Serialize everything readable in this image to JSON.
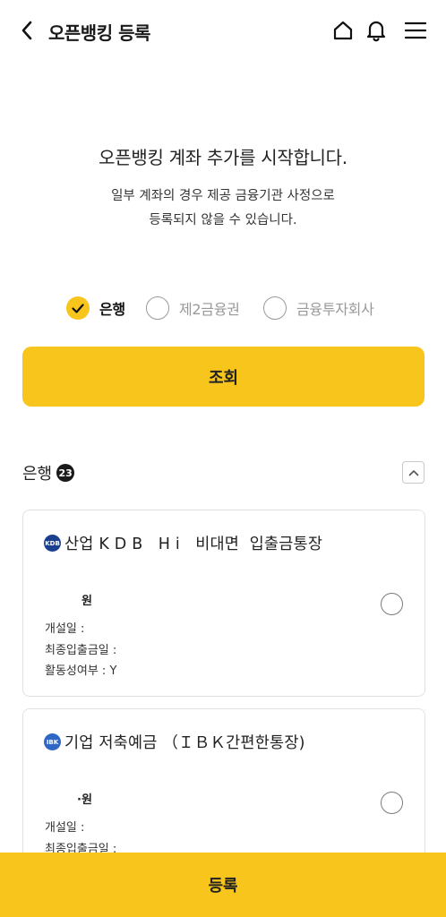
{
  "header": {
    "title": "오픈뱅킹 등록",
    "icons": [
      "back-arrow-icon",
      "home-icon",
      "bell-icon",
      "hamburger-menu-icon"
    ]
  },
  "intro": {
    "title": "오픈뱅킹 계좌 추가를 시작합니다.",
    "desc_line1": "일부 계좌의 경우 제공 금융기관 사정으로",
    "desc_line2": "등록되지 않을 수 있습니다."
  },
  "filters": {
    "options": [
      {
        "label": "은행",
        "checked": true
      },
      {
        "label": "제2금융권",
        "checked": false
      },
      {
        "label": "금융투자회사",
        "checked": false
      }
    ]
  },
  "search_button": "조회",
  "section": {
    "title": "은행",
    "count": "23"
  },
  "accounts": [
    {
      "logo": "KDB",
      "name": "산업 K D B   H i   비대면  입출금통장",
      "balance": "원",
      "opened_label": "개설일 :",
      "last_tx_label": "최종입출금일 :",
      "active_label": "활동성여부 : Y"
    },
    {
      "logo": "IBK",
      "name": "기업 저축예금 （ＩＢＫ간편한통장)",
      "balance": "·원",
      "opened_label": "개설일 :",
      "last_tx_label": "최종입출금일 :"
    }
  ],
  "register_button": "등록",
  "colors": {
    "accent": "#f8c51c",
    "text": "#222222",
    "border": "#e2e2e2"
  }
}
